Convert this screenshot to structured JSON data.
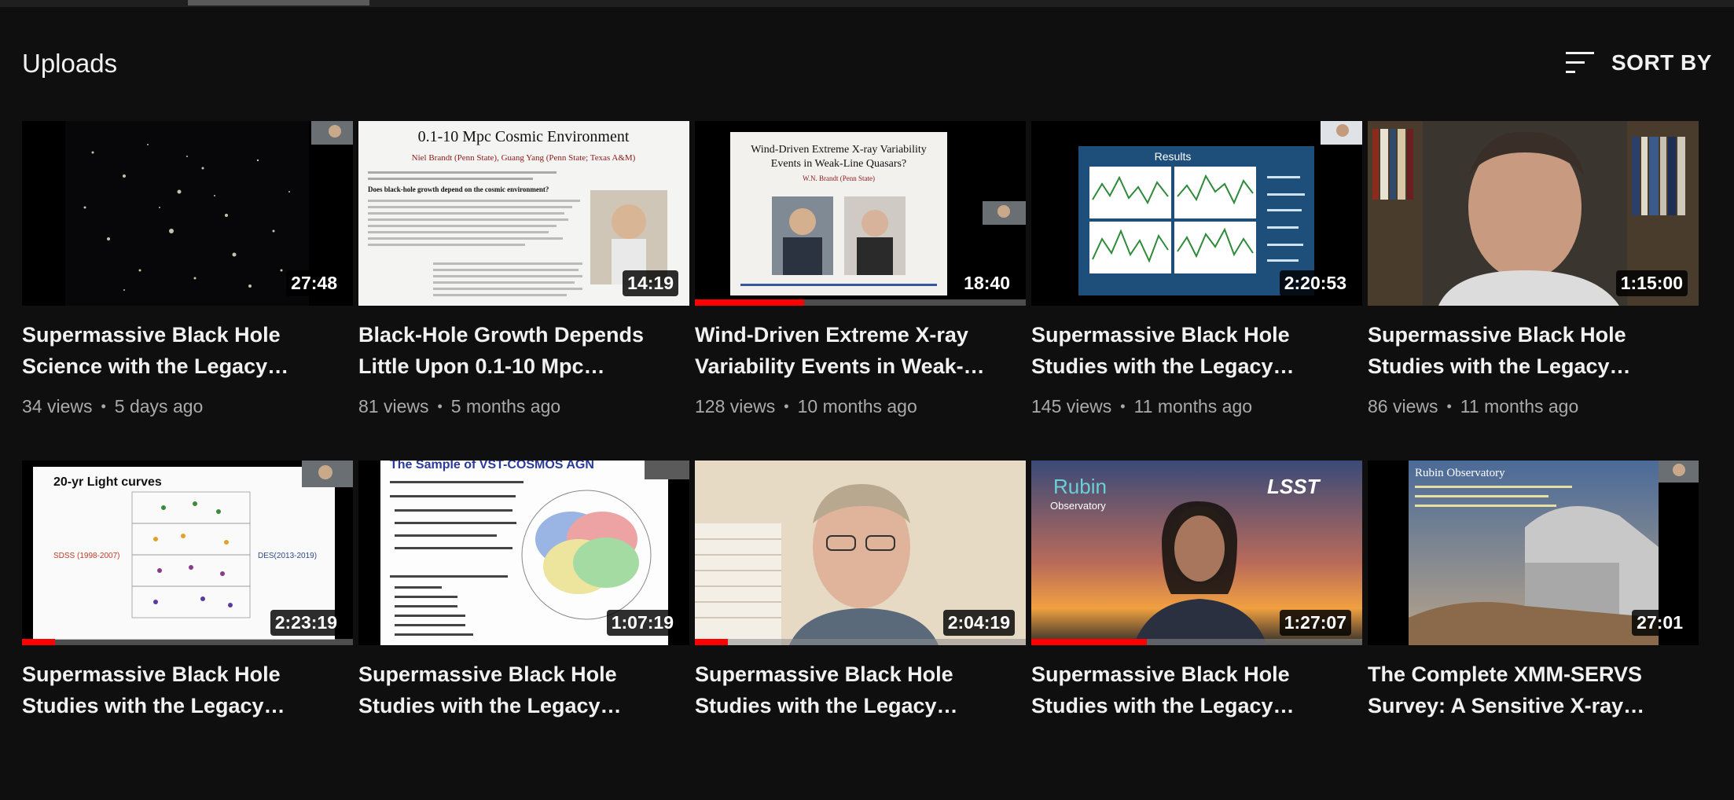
{
  "section": {
    "title": "Uploads",
    "sort_label": "SORT BY",
    "sort_icon": "sort-icon"
  },
  "videos": [
    {
      "title": "Supermassive Black Hole Science with the Legacy…",
      "views": "34 views",
      "age": "5 days ago",
      "duration": "27:48",
      "progress": 0
    },
    {
      "title": "Black-Hole Growth Depends Little Upon 0.1-10 Mpc…",
      "views": "81 views",
      "age": "5 months ago",
      "duration": "14:19",
      "progress": 0,
      "slide_title": "0.1-10 Mpc Cosmic Environment",
      "slide_authors": "Niel Brandt (Penn State), Guang Yang (Penn State; Texas A&M)",
      "slide_question": "Does black-hole growth depend on the cosmic environment?"
    },
    {
      "title": "Wind-Driven Extreme X-ray Variability Events in Weak-…",
      "views": "128 views",
      "age": "10 months ago",
      "duration": "18:40",
      "progress": 0.33,
      "slide_title": "Wind-Driven Extreme X-ray Variability",
      "slide_title2": "Events in Weak-Line Quasars?",
      "slide_authors": "W.N. Brandt (Penn State)"
    },
    {
      "title": "Supermassive Black Hole Studies with the Legacy…",
      "views": "145 views",
      "age": "11 months ago",
      "duration": "2:20:53",
      "progress": 0,
      "slide_title": "Results"
    },
    {
      "title": "Supermassive Black Hole Studies with the Legacy…",
      "views": "86 views",
      "age": "11 months ago",
      "duration": "1:15:00",
      "progress": 0
    },
    {
      "title": "Supermassive Black Hole Studies with the Legacy…",
      "views": "",
      "age": "",
      "duration": "2:23:19",
      "progress": 0.1,
      "slide_title": "20-yr Light curves",
      "slide_left": "SDSS (1998-2007)",
      "slide_right": "DES(2013-2019)"
    },
    {
      "title": "Supermassive Black Hole Studies with the Legacy…",
      "views": "",
      "age": "",
      "duration": "1:07:19",
      "progress": 0,
      "slide_title": "The Sample of VST-COSMOS AGN"
    },
    {
      "title": "Supermassive Black Hole Studies with the Legacy…",
      "views": "",
      "age": "",
      "duration": "2:04:19",
      "progress": 0.1
    },
    {
      "title": "Supermassive Black Hole Studies with the Legacy…",
      "views": "",
      "age": "",
      "duration": "1:27:07",
      "progress": 0.35,
      "slide_title": "Rubin",
      "slide_title2": "Observatory",
      "slide_logo": "LSST"
    },
    {
      "title": "The Complete XMM-SERVS Survey: A Sensitive X-ray…",
      "views": "",
      "age": "",
      "duration": "27:01",
      "progress": 0,
      "slide_title": "Rubin Observatory"
    }
  ]
}
